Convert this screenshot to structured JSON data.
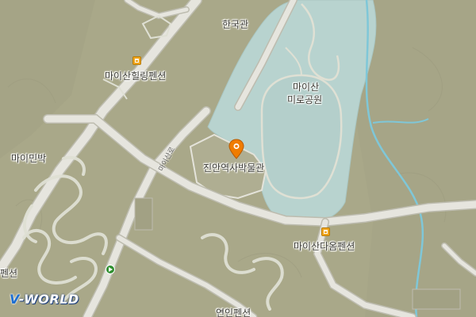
{
  "map": {
    "labels": {
      "hanguk_hall": "한국관",
      "maisan_hilling_pension": "마이산힐링펜션",
      "maisan_maze_park_line1": "마이산",
      "maisan_maze_park_line2": "미로공원",
      "mai_inn": "마이민박",
      "jinan_history_museum": "진안역사박물관",
      "maisan_daum_pension": "마이산다옴펜션",
      "yeonin_pension": "연인펜션",
      "left_edge_partial": "펜션",
      "road_maisan": "마이산로"
    },
    "logo": {
      "prefix": "V",
      "rest": "-WORLD"
    },
    "colors": {
      "land": "#a9a889",
      "water": "#b8d3cf",
      "road": "#e6e5de",
      "road_edge": "#bdbcaf",
      "stream": "#7fc7d8",
      "poi": "#f0a51a",
      "pin": "#f07c00"
    },
    "icons": [
      "lodging-icon",
      "location-pin-icon",
      "route-marker-icon"
    ]
  }
}
